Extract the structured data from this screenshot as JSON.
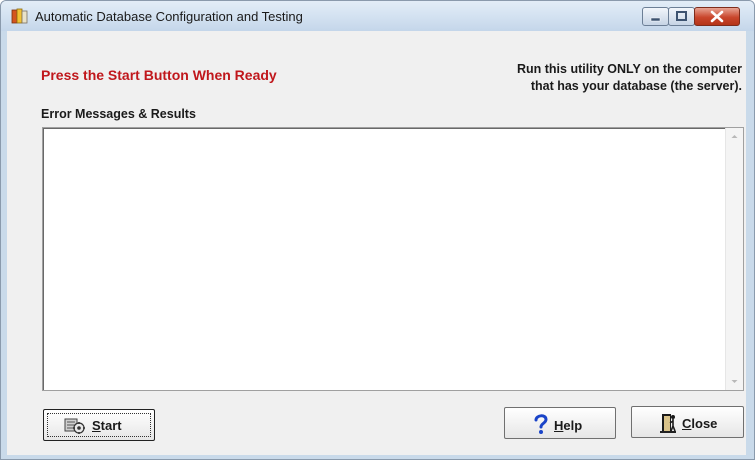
{
  "window": {
    "title": "Automatic Database Configuration and Testing",
    "app_icon": "database-app-icon",
    "caption_buttons": [
      "minimize-icon",
      "maximize-icon",
      "close-icon"
    ]
  },
  "header": {
    "prompt": "Press the Start Button When Ready",
    "prompt_color": "#c0171c",
    "server_note_line1": "Run this utility ONLY on the computer",
    "server_note_line2": "that has your database (the server)."
  },
  "results": {
    "label": "Error Messages & Results",
    "content": ""
  },
  "buttons": {
    "start": {
      "mnemonic": "S",
      "rest": "tart",
      "icon": "database-gears-icon"
    },
    "help": {
      "mnemonic": "H",
      "rest": "elp",
      "icon": "question-mark-icon"
    },
    "close": {
      "mnemonic": "C",
      "rest": "lose",
      "icon": "door-exit-icon"
    }
  }
}
